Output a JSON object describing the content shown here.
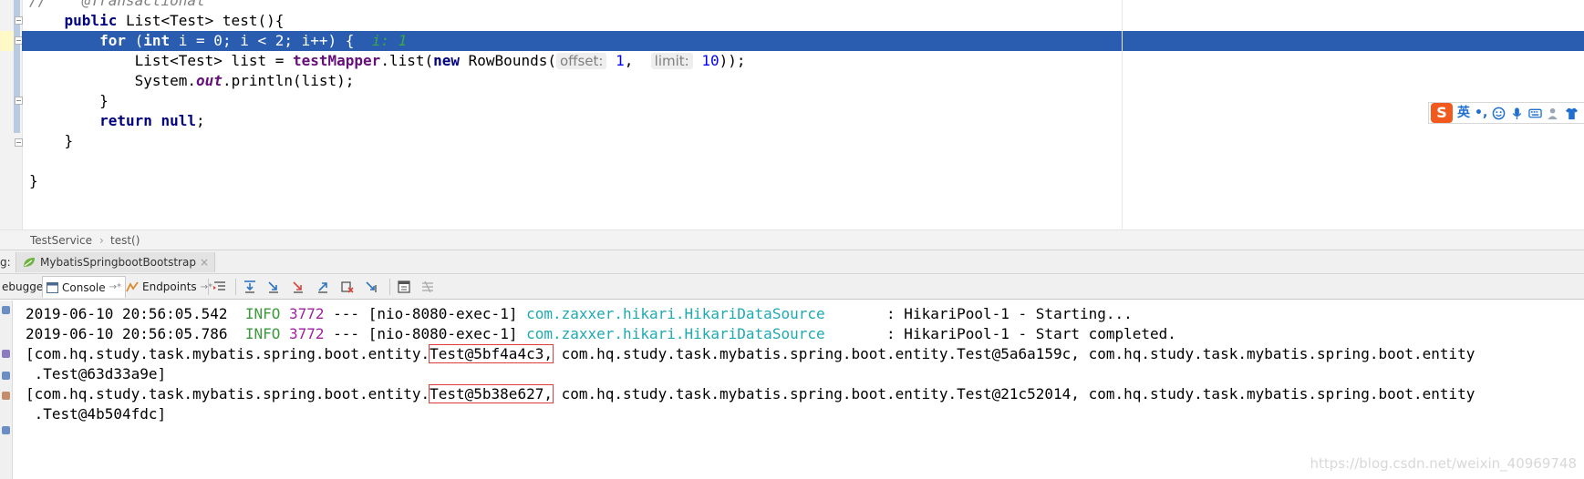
{
  "editor": {
    "lines": {
      "annotation": "//    @Transactional",
      "method_kw": "public",
      "method_rest": " List<Test> test(){",
      "for_kw": "for",
      "for_open": " (",
      "int_kw": "int",
      "for_rest": " i = 0; i < 2; i++) {  ",
      "for_hint": "i: 1",
      "list_decl": "List<Test> list = ",
      "mapper_field": "testMapper",
      "list_call": ".list(",
      "new_kw": "new",
      "rowbounds": " RowBounds(",
      "hint_offset": "offset:",
      "offset_value": "1",
      "comma": ",",
      "hint_limit": "limit:",
      "limit_value": "10",
      "call_close": "));",
      "sys_prefix": "System.",
      "sys_out": "out",
      "sys_suffix": ".println(list);",
      "for_close": "}",
      "return_kw": "return",
      "null_kw": "null",
      "semicolon": ";",
      "method_close": "}",
      "class_close": "}"
    }
  },
  "ime": {
    "logo": "S",
    "lang": "英",
    "punct": "•,",
    "icons": [
      "smile-icon",
      "microphone-icon",
      "keyboard-icon",
      "person-icon",
      "shirt-icon"
    ]
  },
  "breadcrumb": {
    "class_name": "TestService",
    "separator": "›",
    "method_name": "test()"
  },
  "run": {
    "label": "g:",
    "config_name": "MybatisSpringbootBootstrap",
    "close": "×"
  },
  "toolbar": {
    "debugger_tab": "ebugger",
    "console_tab": "Console",
    "endpoints_tab": "Endpoints",
    "pin": "→*"
  },
  "console": {
    "log1": {
      "timestamp": "2019-06-10 20:56:05.542",
      "level": "INFO",
      "pid": "3772",
      "thread": " --- [nio-8080-exec-1] ",
      "logger": "com.zaxxer.hikari.HikariDataSource",
      "message": "       : HikariPool-1 - Starting..."
    },
    "log2": {
      "timestamp": "2019-06-10 20:56:05.786",
      "level": "INFO",
      "pid": "3772",
      "thread": " --- [nio-8080-exec-1] ",
      "logger": "com.zaxxer.hikari.HikariDataSource",
      "message": "       : HikariPool-1 - Start completed."
    },
    "out1": {
      "prefix": "[com.hq.study.task.mybatis.spring.boot.entity.",
      "boxed": "Test@5bf4a4c3,",
      "rest": " com.hq.study.task.mybatis.spring.boot.entity.Test@5a6a159c, com.hq.study.task.mybatis.spring.boot.entity",
      "cont": " .Test@63d33a9e]"
    },
    "out2": {
      "prefix": "[com.hq.study.task.mybatis.spring.boot.entity.",
      "boxed": "Test@5b38e627,",
      "rest": " com.hq.study.task.mybatis.spring.boot.entity.Test@21c52014, com.hq.study.task.mybatis.spring.boot.entity",
      "cont": " .Test@4b504fdc]"
    }
  },
  "watermark": "https://blog.csdn.net/weixin_40969748",
  "colors": {
    "highlight_line": "#2a5db0",
    "keyword": "#000080",
    "field": "#660e7a",
    "info": "#3c9a3c",
    "logger": "#1ea9b3",
    "box": "#e03c3c"
  }
}
